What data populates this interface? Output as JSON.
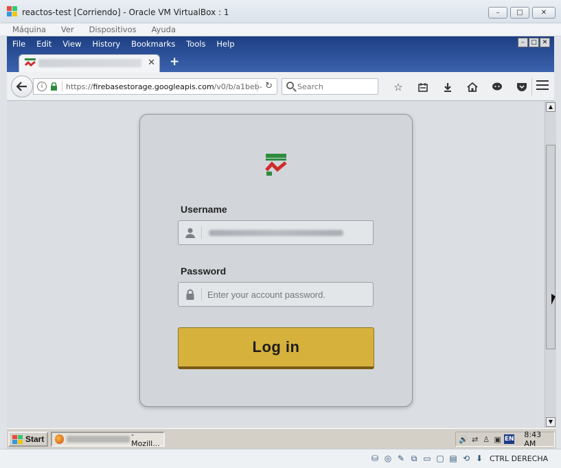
{
  "vbox": {
    "title": "reactos-test [Corriendo] - Oracle VM VirtualBox : 1",
    "menu": [
      "Máquina",
      "Ver",
      "Dispositivos",
      "Ayuda"
    ],
    "status_hostkey": "CTRL DERECHA",
    "window_controls": [
      "–",
      "□",
      "✕"
    ]
  },
  "firefox": {
    "menu": [
      "File",
      "Edit",
      "View",
      "History",
      "Bookmarks",
      "Tools",
      "Help"
    ],
    "tab": {
      "close_glyph": "✕",
      "new_tab_glyph": "+"
    },
    "url": {
      "scheme": "https://",
      "host": "firebasestorage.googleapis.com",
      "path": "/v0/b/a1beb-"
    },
    "search": {
      "placeholder": "Search"
    },
    "toolbar_icons": [
      "star-icon",
      "reading-list-icon",
      "download-icon",
      "home-icon",
      "chat-icon",
      "pocket-icon"
    ]
  },
  "login": {
    "username_label": "Username",
    "password_label": "Password",
    "password_placeholder": "Enter your account password.",
    "login_button": "Log in"
  },
  "taskbar": {
    "start_label": "Start",
    "task_suffix": "- Mozill...",
    "lang": "EN",
    "clock": "8:43 AM"
  }
}
